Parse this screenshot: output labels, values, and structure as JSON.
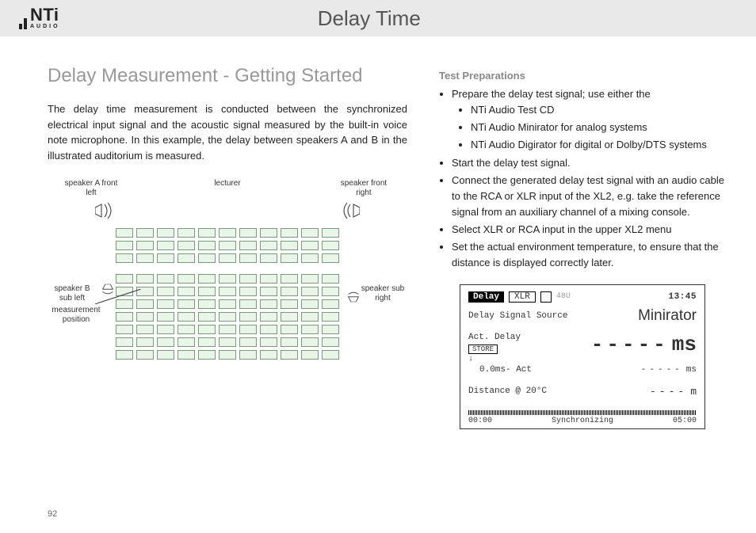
{
  "logo": {
    "brand": "NTi",
    "sub": "AUDIO"
  },
  "page_title": "Delay Time",
  "section_heading": "Delay Measurement - Getting Started",
  "intro_paragraph": "The delay time measurement is conducted between the synchronized electrical input signal and the acoustic signal measured by the built-in voice note microphone. In this example, the delay between speakers A and B in the illustrated auditorium is measured.",
  "diagram": {
    "speaker_a": "speaker A front left",
    "lecturer": "lecturer",
    "speaker_front_right": "speaker front right",
    "speaker_b": "speaker B sub left",
    "speaker_sub_right": "speaker sub right",
    "measurement_position": "measurement position"
  },
  "prep_heading": "Test Preparations",
  "prep_items": {
    "b1": "Prepare the delay test signal; use either the",
    "b1a": "NTi Audio Test CD",
    "b1b": "NTi Audio Minirator for analog systems",
    "b1c": "NTi Audio Digirator for digital or Dolby/DTS systems",
    "b2": "Start the delay test signal.",
    "b3": "Connect the generated delay test signal with an audio cable to the RCA or XLR input of the XL2, e.g. take the reference signal from an auxiliary channel of a mixing console.",
    "b4": "Select XLR or RCA input in the upper XL2 menu",
    "b5": "Set the actual environment temperature, to ensure that the distance is displayed correctly later."
  },
  "device": {
    "mode": "Delay",
    "input": "XLR",
    "phantom": "48U",
    "time": "13:45",
    "src_label": "Delay Signal Source",
    "src_value": "Minirator",
    "act_label": "Act. Delay",
    "store": "STORE",
    "dashes_big": "-----",
    "unit_big": "ms",
    "ref_row_left": "0.0ms- Act",
    "ref_dashes": "-----",
    "ref_unit": "ms",
    "dist_label": "Distance @  20°C",
    "dist_dashes": "----",
    "dist_unit": "m",
    "t_start": "00:00",
    "sync": "Synchronizing",
    "t_end": "05:00"
  },
  "page_number": "92"
}
